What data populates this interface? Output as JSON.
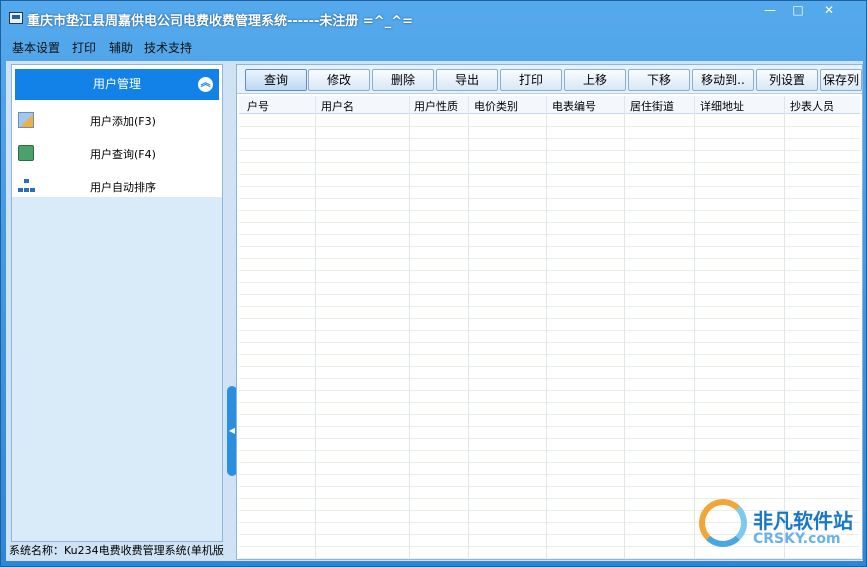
{
  "window": {
    "title": "重庆市垫江县周嘉供电公司电费收费管理系统------未注册 =^_^=",
    "controls": {
      "minimize": "—",
      "maximize": "□",
      "close": "✕"
    }
  },
  "menu": [
    "基本设置",
    "打印",
    "辅助",
    "技术支持"
  ],
  "sidebar": {
    "group_title": "用户管理",
    "collapse_icon": "chevron-double-up-icon",
    "items": [
      {
        "label": "用户添加(F3)",
        "icon": "user-add-icon"
      },
      {
        "label": "用户查询(F4)",
        "icon": "user-query-icon"
      },
      {
        "label": "用户自动排序",
        "icon": "tree-sort-icon"
      }
    ]
  },
  "toolbar": {
    "buttons": [
      "查询",
      "修改",
      "删除",
      "导出",
      "打印",
      "上移",
      "下移",
      "移动到..",
      "列设置",
      "保存列"
    ]
  },
  "grid": {
    "columns": [
      "户号",
      "用户名",
      "用户性质",
      "电价类别",
      "电表编号",
      "居住街道",
      "详细地址",
      "抄表人员"
    ]
  },
  "status_bar": {
    "text": "系统名称：Ku234电费收费管理系统(单机版"
  },
  "watermark": {
    "name": "非凡软件站",
    "site": "CRSKY.com"
  },
  "colors": {
    "title_bar": "#3d8fd6",
    "group_header": "#1382e8",
    "panel_bg": "#cfe3f5"
  }
}
